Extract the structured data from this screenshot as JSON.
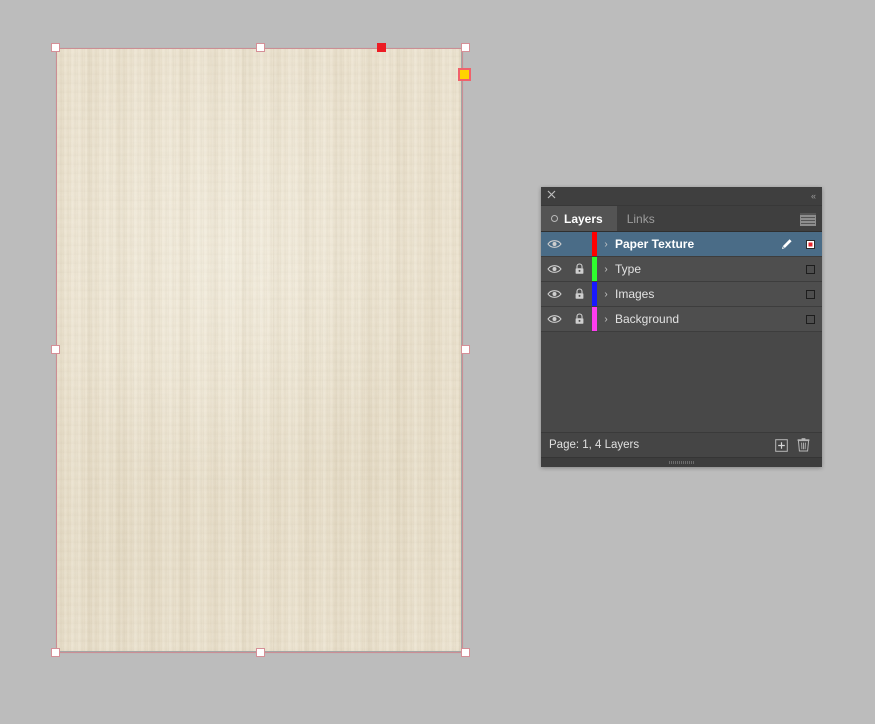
{
  "app": {
    "background_color": "#bcbcbc",
    "paper_color": "#ece2cd",
    "selection_color": "#cc8e94"
  },
  "canvas": {
    "artboard_name": "paper-texture-artboard",
    "handles": [
      {
        "name": "handle-top-left",
        "position": "top-left",
        "state": "normal"
      },
      {
        "name": "handle-top-center",
        "position": "top-center",
        "state": "normal"
      },
      {
        "name": "handle-top-right-active",
        "position": "top-right-active",
        "state": "active"
      },
      {
        "name": "handle-top-right",
        "position": "top-right",
        "state": "normal"
      },
      {
        "name": "handle-middle-left",
        "position": "middle-left",
        "state": "normal"
      },
      {
        "name": "handle-middle-right",
        "position": "middle-right",
        "state": "normal"
      },
      {
        "name": "handle-bottom-left",
        "position": "bottom-left",
        "state": "normal"
      },
      {
        "name": "handle-bottom-center",
        "position": "bottom-center",
        "state": "normal"
      },
      {
        "name": "handle-bottom-right",
        "position": "bottom-right",
        "state": "normal"
      }
    ],
    "corner_widget": {
      "name": "corner-options-widget",
      "fill": "#ffd400",
      "stroke": "#f0616b"
    }
  },
  "panel": {
    "titlebar": {
      "close_icon": "close-icon",
      "collapse_icon": "collapse-panel-icon",
      "collapse_glyph": "«"
    },
    "tabs": [
      {
        "label": "Layers",
        "active": true,
        "icon": "layers-tab-dot"
      },
      {
        "label": "Links",
        "active": false,
        "icon": ""
      }
    ],
    "menu_icon": "panel-menu-icon",
    "layers": [
      {
        "name": "Paper Texture",
        "color": "#ff0000",
        "visible": true,
        "locked": false,
        "selected": true,
        "has_pen": true,
        "target_active": true,
        "disclosure": "›"
      },
      {
        "name": "Type",
        "color": "#2dff2d",
        "visible": true,
        "locked": true,
        "selected": false,
        "has_pen": false,
        "target_active": false,
        "disclosure": "›"
      },
      {
        "name": "Images",
        "color": "#1818ff",
        "visible": true,
        "locked": true,
        "selected": false,
        "has_pen": false,
        "target_active": false,
        "disclosure": "›"
      },
      {
        "name": "Background",
        "color": "#ff3cf0",
        "visible": true,
        "locked": true,
        "selected": false,
        "has_pen": false,
        "target_active": false,
        "disclosure": "›"
      }
    ],
    "footer": {
      "status": "Page: 1, 4 Layers",
      "new_layer_button": "new-layer-button",
      "delete_layer_button": "delete-layer-button"
    }
  }
}
